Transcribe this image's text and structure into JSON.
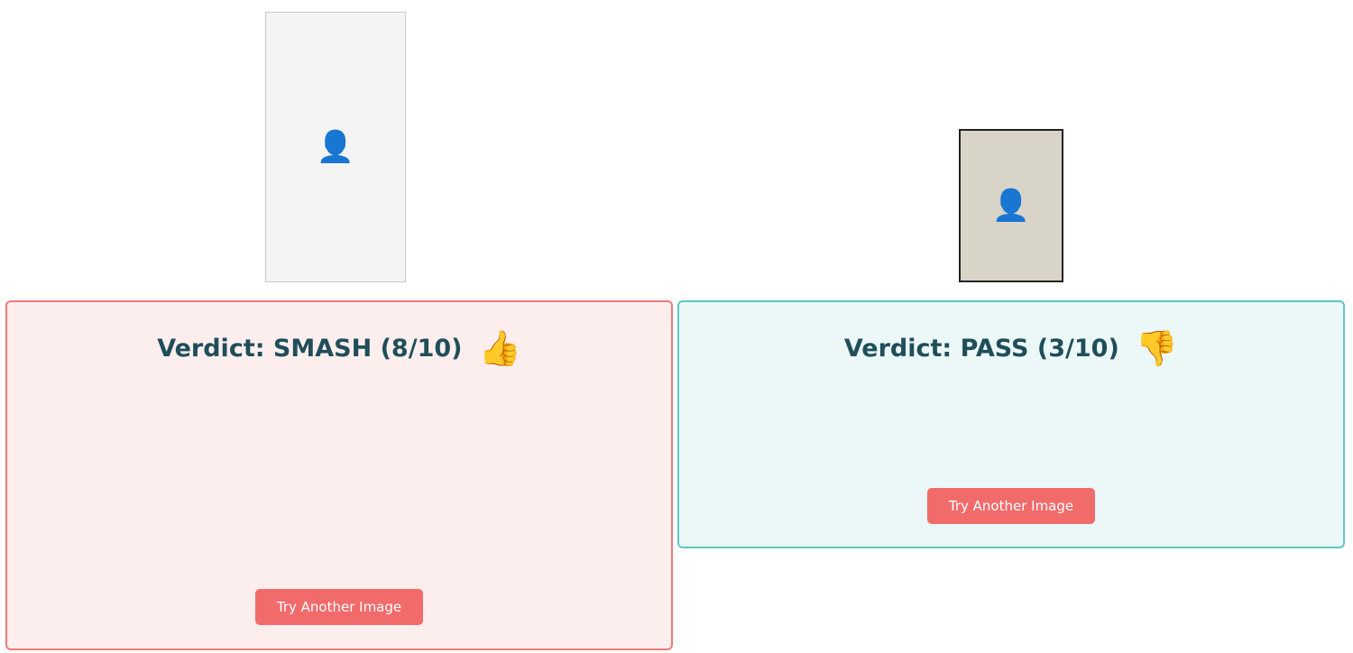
{
  "left": {
    "image_icon": "person-photo-icon",
    "verdict_label": "Verdict: SMASH (8/10)",
    "thumb_icon": "thumbs-up-icon",
    "verdict_text": "",
    "button_label": "Try Another Image",
    "accent": "#f07a78"
  },
  "right": {
    "image_icon": "person-photo-icon",
    "verdict_label": "Verdict: PASS (3/10)",
    "thumb_icon": "thumbs-down-icon",
    "verdict_text": "",
    "button_label": "Try Another Image",
    "accent": "#5ec8c0"
  },
  "button_color": "#f26b6b"
}
